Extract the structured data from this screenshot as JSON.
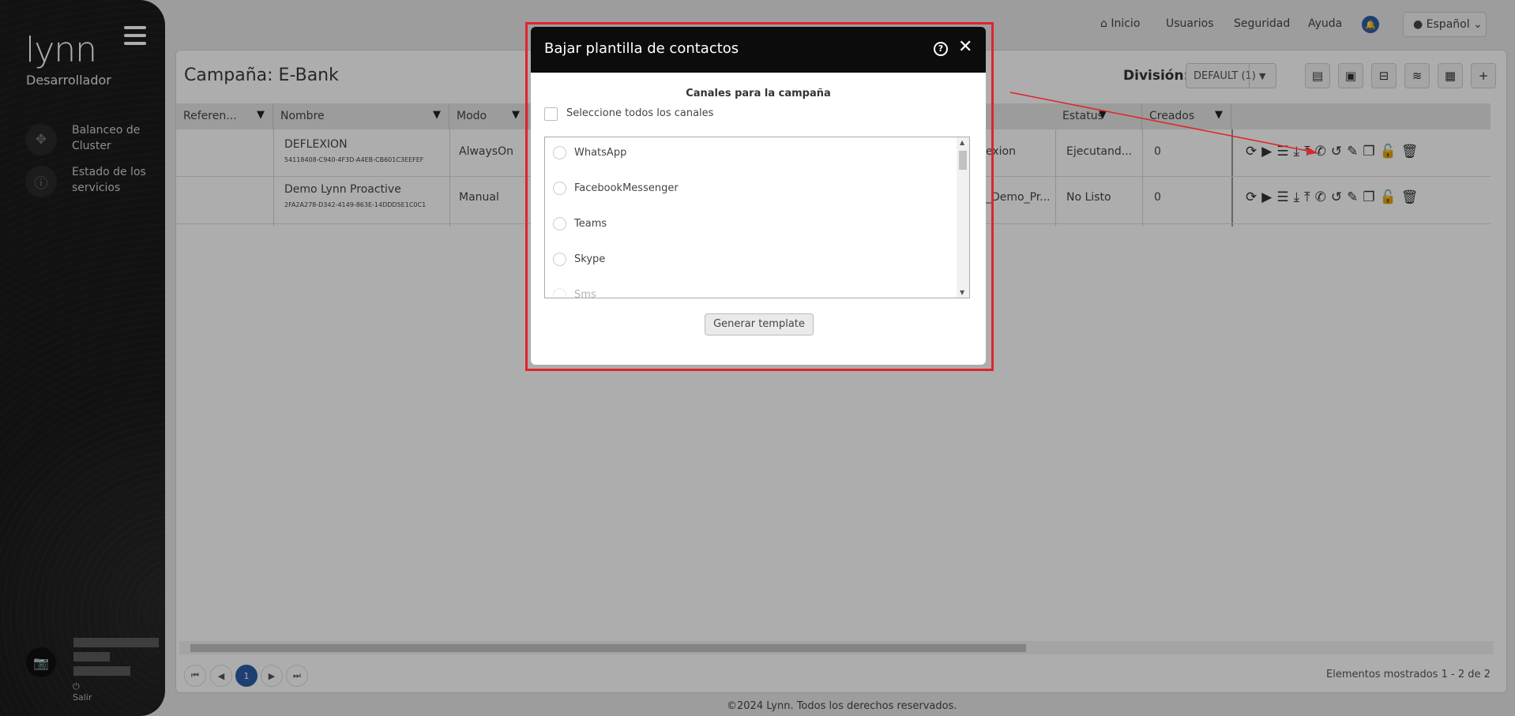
{
  "sidebar": {
    "logo": "lynn",
    "role": "Desarrollador",
    "items": [
      {
        "label": "Balanceo de Cluster",
        "icon": "network-icon"
      },
      {
        "label": "Estado de los servicios",
        "icon": "info-icon"
      }
    ],
    "logout": "Salir"
  },
  "topnav": {
    "inicio": "Inicio",
    "usuarios": "Usuarios",
    "seguridad": "Seguridad",
    "ayuda": "Ayuda",
    "language": "Español"
  },
  "page": {
    "title": "Campaña: E-Bank",
    "division_label": "División:",
    "division_value": "DEFAULT (1)"
  },
  "table": {
    "columns": [
      "Referen...",
      "Nombre",
      "Modo",
      "Estatus",
      "Creados"
    ],
    "rows": [
      {
        "nombre": "DEFLEXION",
        "id": "54118408-C940-4F3D-A4EB-CB601C3EEFEF",
        "modo": "AlwaysOn",
        "col_hidden": "exion",
        "estatus": "Ejecutand...",
        "creados": "0"
      },
      {
        "nombre": "Demo Lynn Proactive",
        "id": "2FA2A278-D342-4149-863E-14DDD5E1C0C1",
        "modo": "Manual",
        "col_hidden": "_Demo_Pr...",
        "estatus": "No Listo",
        "creados": "0"
      }
    ]
  },
  "pagination": {
    "current": "1",
    "shown": "Elementos mostrados 1 - 2 de 2"
  },
  "footer": "©2024 Lynn. Todos los derechos reservados.",
  "modal": {
    "title": "Bajar plantilla de contactos",
    "section_title": "Canales para la campaña",
    "select_all": "Seleccione todos los canales",
    "channels": [
      "WhatsApp",
      "FacebookMessenger",
      "Teams",
      "Skype",
      "Sms"
    ],
    "button": "Generar template"
  },
  "colors": {
    "accent": "#2d5ea8",
    "highlight": "#e0242b",
    "header": "#0c0c0c"
  }
}
